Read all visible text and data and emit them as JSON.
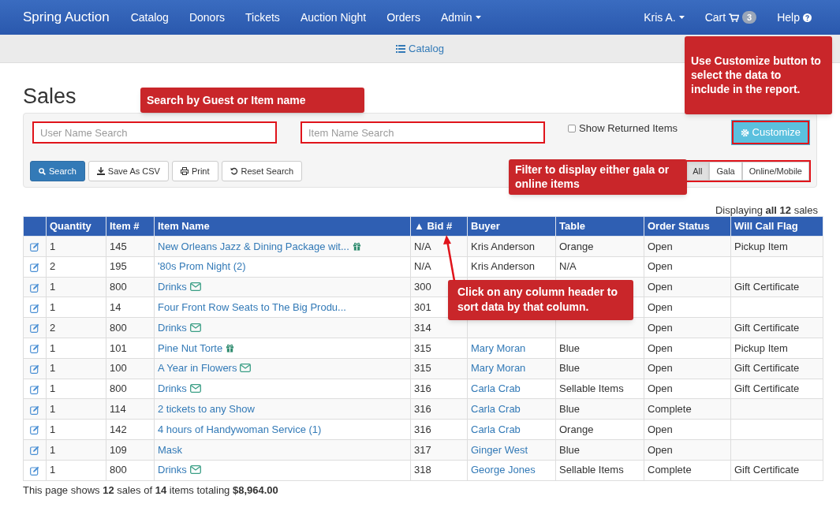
{
  "navbar": {
    "brand": "Spring Auction",
    "items": [
      "Catalog",
      "Donors",
      "Tickets",
      "Auction Night",
      "Orders",
      "Admin"
    ],
    "user": "Kris A.",
    "cart": {
      "label": "Cart",
      "count": "3"
    },
    "help": "Help"
  },
  "breadcrumb": "Catalog",
  "title": "Sales",
  "search": {
    "user_placeholder": "User Name Search",
    "item_placeholder": "Item Name Search",
    "show_returned": {
      "label": "Show Returned Items",
      "checked": false
    },
    "customize": "Customize",
    "buttons": [
      {
        "label": "Search",
        "kind": "primary"
      },
      {
        "label": "Save As CSV",
        "kind": "download"
      },
      {
        "label": "Print",
        "kind": "print"
      },
      {
        "label": "Reset Search",
        "kind": "reset"
      }
    ],
    "filters": [
      {
        "label": "All",
        "selected": true
      },
      {
        "label": "Gala",
        "selected": false
      },
      {
        "label": "Online/Mobile",
        "selected": false
      }
    ]
  },
  "displaying": "Displaying **all 12** sales",
  "table": {
    "columns": [
      "Quantity",
      "Item #",
      "Item Name",
      "▲ Bid #",
      "Buyer",
      "Table",
      "Order Status",
      "Will Call Flag"
    ],
    "rows": [
      {
        "quantity": "1",
        "item_no": "145",
        "item_name": "New Orleans Jazz & Dining Package wit...",
        "kind": "gift",
        "bid": "N/A",
        "buyer": "Kris Anderson",
        "buyer_link": false,
        "table": "Orange",
        "status": "Open",
        "flag": "Pickup Item"
      },
      {
        "quantity": "2",
        "item_no": "195",
        "item_name": "'80s Prom Night (2)",
        "bid": "N/A",
        "buyer": "Kris Anderson",
        "buyer_link": false,
        "table": "N/A",
        "status": "Open"
      },
      {
        "quantity": "1",
        "item_no": "800",
        "item_name": "Drinks",
        "kind": "envelope",
        "bid": "300",
        "status": "Open",
        "flag": "Gift Certificate"
      },
      {
        "quantity": "1",
        "item_no": "14",
        "item_name": "Four Front Row Seats to The Big Produ...",
        "bid": "301",
        "status": "Open"
      },
      {
        "quantity": "2",
        "item_no": "800",
        "item_name": "Drinks",
        "kind": "envelope",
        "bid": "314",
        "status": "Open",
        "flag": "Gift Certificate"
      },
      {
        "quantity": "1",
        "item_no": "101",
        "item_name": "Pine Nut Torte",
        "kind": "gift",
        "bid": "315",
        "buyer": "Mary Moran",
        "buyer_link": true,
        "table": "Blue",
        "status": "Open",
        "flag": "Pickup Item"
      },
      {
        "quantity": "1",
        "item_no": "100",
        "item_name": "A Year in Flowers",
        "kind": "envelope",
        "bid": "315",
        "buyer": "Mary Moran",
        "buyer_link": true,
        "table": "Blue",
        "status": "Open",
        "flag": "Gift Certificate"
      },
      {
        "quantity": "1",
        "item_no": "800",
        "item_name": "Drinks",
        "kind": "envelope",
        "bid": "316",
        "buyer": "Carla Crab",
        "buyer_link": true,
        "table": "Sellable Items",
        "status": "Open",
        "flag": "Gift Certificate"
      },
      {
        "quantity": "1",
        "item_no": "114",
        "item_name": "2 tickets to any Show",
        "bid": "316",
        "buyer": "Carla Crab",
        "buyer_link": true,
        "table": "Blue",
        "status": "Complete"
      },
      {
        "quantity": "1",
        "item_no": "142",
        "item_name": "4 hours of Handywoman Service (1)",
        "bid": "316",
        "buyer": "Carla Crab",
        "buyer_link": true,
        "table": "Orange",
        "status": "Open"
      },
      {
        "quantity": "1",
        "item_no": "109",
        "item_name": "Mask",
        "bid": "317",
        "buyer": "Ginger West",
        "buyer_link": true,
        "table": "Blue",
        "status": "Open"
      },
      {
        "quantity": "1",
        "item_no": "800",
        "item_name": "Drinks",
        "kind": "envelope",
        "bid": "318",
        "buyer": "George Jones",
        "buyer_link": true,
        "table": "Sellable Items",
        "status": "Complete",
        "flag": "Gift Certificate"
      }
    ]
  },
  "summary": "This page shows **12** sales of **14** items totaling **$8,964.00**",
  "annotations": [
    "Use Customize button to select the data to include in the report.",
    "Search by Guest or Item name",
    "Filter to display either gala or online items",
    "Click on any column header to sort data by that column."
  ]
}
